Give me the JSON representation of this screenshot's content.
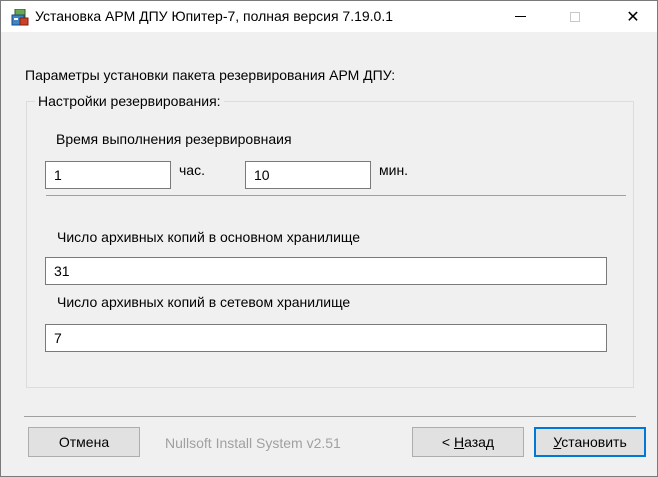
{
  "window": {
    "title": "Установка АРМ ДПУ Юпитер-7, полная версия 7.19.0.1",
    "icon": "installer-icon",
    "controls": {
      "minimize": "minimize-icon",
      "maximize": "maximize-icon",
      "close": "close-icon"
    },
    "close_glyph": "✕"
  },
  "page": {
    "header": "Параметры установки пакета резервирования АРМ ДПУ:"
  },
  "group": {
    "label": "Настройки резервирования:",
    "time_label": "Время выполнения резервировнаия",
    "hours_value": "1",
    "hours_unit": "час.",
    "minutes_value": "10",
    "minutes_unit": "мин.",
    "main_copies_label": "Число архивных копий в основном хранилище",
    "main_copies_value": "31",
    "network_copies_label": "Число архивных копий в сетевом хранилище",
    "network_copies_value": "7"
  },
  "footer": {
    "cancel_label": "Отмена",
    "branding": "Nullsoft Install System v2.51",
    "back_prefix": "< ",
    "back_hotkey": "Н",
    "back_rest": "азад",
    "install_hotkey": "У",
    "install_rest": "становить"
  }
}
